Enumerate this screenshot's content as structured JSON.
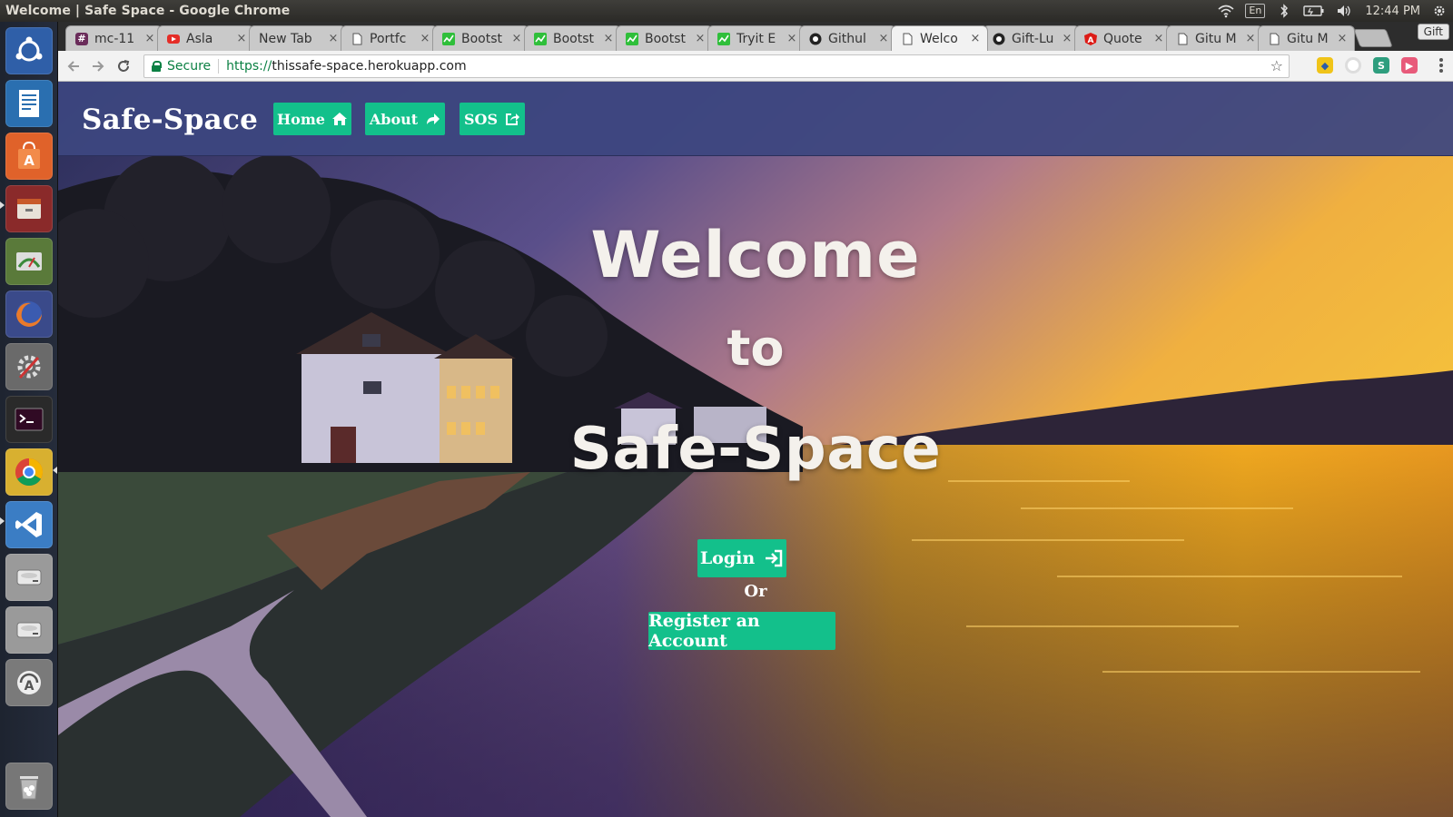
{
  "os": {
    "window_title": "Welcome | Safe Space - Google Chrome",
    "keyboard_layout": "En",
    "clock": "12:44 PM",
    "launcher": [
      {
        "name": "ubuntu-dash-icon",
        "color": "#2f5fa8"
      },
      {
        "name": "libreoffice-writer-icon",
        "color": "#2a6fb0"
      },
      {
        "name": "ubuntu-software-icon",
        "color": "#e0622a"
      },
      {
        "name": "file-manager-icon",
        "color": "#8a2a2a"
      },
      {
        "name": "system-monitor-icon",
        "color": "#5a7a3a"
      },
      {
        "name": "firefox-icon",
        "color": "#e8742a"
      },
      {
        "name": "settings-icon",
        "color": "#6a6a6a"
      },
      {
        "name": "terminal-icon",
        "color": "#2a2a2a"
      },
      {
        "name": "chrome-icon",
        "color": "#d8b030"
      },
      {
        "name": "vscode-icon",
        "color": "#3b7dc4"
      },
      {
        "name": "disk-icon",
        "color": "#9a9a9a"
      },
      {
        "name": "disk-icon-2",
        "color": "#9a9a9a"
      },
      {
        "name": "software-updater-icon",
        "color": "#7a7a7a"
      },
      {
        "name": "trash-icon",
        "color": "#777777"
      }
    ]
  },
  "browser": {
    "tabs": [
      {
        "label": "mc-11",
        "favicon": "#",
        "fav_color": "#6a2c5a",
        "active": false
      },
      {
        "label": "Asla",
        "favicon": "youtube",
        "fav_color": "#e52d27",
        "active": false
      },
      {
        "label": "New Tab",
        "favicon": "",
        "fav_color": "",
        "active": false
      },
      {
        "label": "Portfc",
        "favicon": "page",
        "fav_color": "#777777",
        "active": false
      },
      {
        "label": "Bootst",
        "favicon": "chart",
        "fav_color": "#2fbf3a",
        "active": false
      },
      {
        "label": "Bootst",
        "favicon": "chart",
        "fav_color": "#2fbf3a",
        "active": false
      },
      {
        "label": "Bootst",
        "favicon": "chart",
        "fav_color": "#2fbf3a",
        "active": false
      },
      {
        "label": "Tryit E",
        "favicon": "chart",
        "fav_color": "#2fbf3a",
        "active": false
      },
      {
        "label": "Githul",
        "favicon": "github",
        "fav_color": "#222222",
        "active": false
      },
      {
        "label": "Welco",
        "favicon": "page",
        "fav_color": "#777777",
        "active": true
      },
      {
        "label": "Gift-Lu",
        "favicon": "github",
        "fav_color": "#222222",
        "active": false
      },
      {
        "label": "Quote",
        "favicon": "A",
        "fav_color": "#dd1b16",
        "active": false
      },
      {
        "label": "Gitu M",
        "favicon": "page",
        "fav_color": "#777777",
        "active": false
      },
      {
        "label": "Gitu M",
        "favicon": "page",
        "fav_color": "#777777",
        "active": false
      }
    ],
    "profile": "Gift",
    "security_label": "Secure",
    "url_scheme": "https://",
    "url_host": "thissafe-space.herokuapp.com"
  },
  "site": {
    "brand": "Safe-Space",
    "nav": {
      "home": "Home",
      "about": "About",
      "sos": "SOS"
    },
    "hero": {
      "line1": "Welcome",
      "line2": "to",
      "line3": "Safe-Space"
    },
    "login": "Login",
    "or": "Or",
    "register": "Register an Account",
    "accent_color": "#13c08b",
    "navbar_color": "#3d4680"
  }
}
